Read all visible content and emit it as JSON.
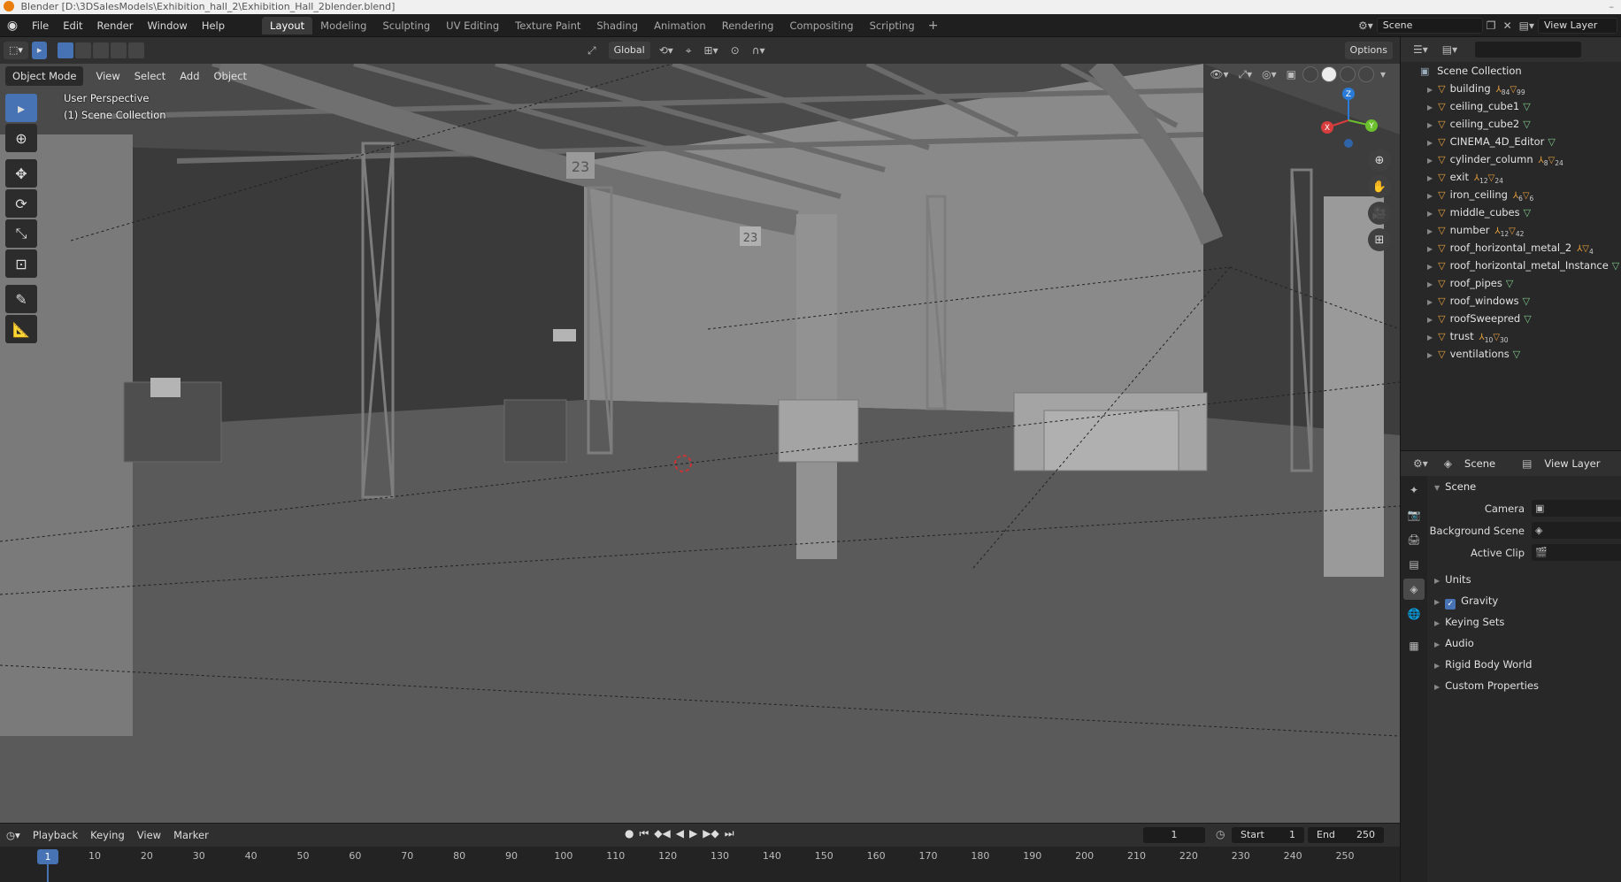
{
  "window": {
    "title": "Blender [D:\\3DSalesModels\\Exhibition_hall_2\\Exhibition_Hall_2blender.blend]",
    "close": "–"
  },
  "menu": [
    "File",
    "Edit",
    "Render",
    "Window",
    "Help"
  ],
  "workspaces": [
    "Layout",
    "Modeling",
    "Sculpting",
    "UV Editing",
    "Texture Paint",
    "Shading",
    "Animation",
    "Rendering",
    "Compositing",
    "Scripting"
  ],
  "active_workspace": "Layout",
  "top_right": {
    "scene": "Scene",
    "view_layer": "View Layer"
  },
  "viewport_header": {
    "transform_orientation": "Global",
    "options": "Options"
  },
  "viewport_menu": {
    "mode": "Object Mode",
    "items": [
      "View",
      "Select",
      "Add",
      "Object"
    ]
  },
  "viewport_info": {
    "perspective": "User Perspective",
    "collection": "(1) Scene Collection"
  },
  "scene_marks": {
    "number_sign_1": "23",
    "number_sign_2": "23"
  },
  "gizmo": {
    "x": "X",
    "y": "Y",
    "z": "Z"
  },
  "outliner": {
    "root": "Scene Collection",
    "search_placeholder": "",
    "items": [
      {
        "name": "building",
        "a": "84",
        "b": "99"
      },
      {
        "name": "ceiling_cube1",
        "a": "",
        "b": ""
      },
      {
        "name": "ceiling_cube2",
        "a": "",
        "b": ""
      },
      {
        "name": "CINEMA_4D_Editor",
        "a": "",
        "b": ""
      },
      {
        "name": "cylinder_column",
        "a": "8",
        "b": "24"
      },
      {
        "name": "exit",
        "a": "12",
        "b": "24"
      },
      {
        "name": "iron_ceiling",
        "a": "6",
        "b": "6"
      },
      {
        "name": "middle_cubes",
        "a": "",
        "b": ""
      },
      {
        "name": "number",
        "a": "12",
        "b": "42"
      },
      {
        "name": "roof_horizontal_metal_2",
        "a": "",
        "b": "4"
      },
      {
        "name": "roof_horizontal_metal_Instance",
        "a": "",
        "b": ""
      },
      {
        "name": "roof_pipes",
        "a": "",
        "b": ""
      },
      {
        "name": "roof_windows",
        "a": "",
        "b": ""
      },
      {
        "name": "roofSweepred",
        "a": "",
        "b": ""
      },
      {
        "name": "trust",
        "a": "10",
        "b": "30"
      },
      {
        "name": "ventilations",
        "a": "",
        "b": ""
      }
    ]
  },
  "properties": {
    "header_scene": "Scene",
    "header_view_layer": "View Layer",
    "panel_title": "Scene",
    "camera_label": "Camera",
    "background_scene_label": "Background Scene",
    "active_clip_label": "Active Clip",
    "subpanels": [
      "Units",
      "Gravity",
      "Keying Sets",
      "Audio",
      "Rigid Body World",
      "Custom Properties"
    ],
    "gravity_checked": true
  },
  "timeline": {
    "menu": [
      "Playback",
      "Keying",
      "View",
      "Marker"
    ],
    "current_frame": "1",
    "start_label": "Start",
    "start": "1",
    "end_label": "End",
    "end": "250",
    "ticks": [
      "1",
      "10",
      "20",
      "30",
      "40",
      "50",
      "60",
      "70",
      "80",
      "90",
      "100",
      "110",
      "120",
      "130",
      "140",
      "150",
      "160",
      "170",
      "180",
      "190",
      "200",
      "210",
      "220",
      "230",
      "240",
      "250"
    ]
  }
}
